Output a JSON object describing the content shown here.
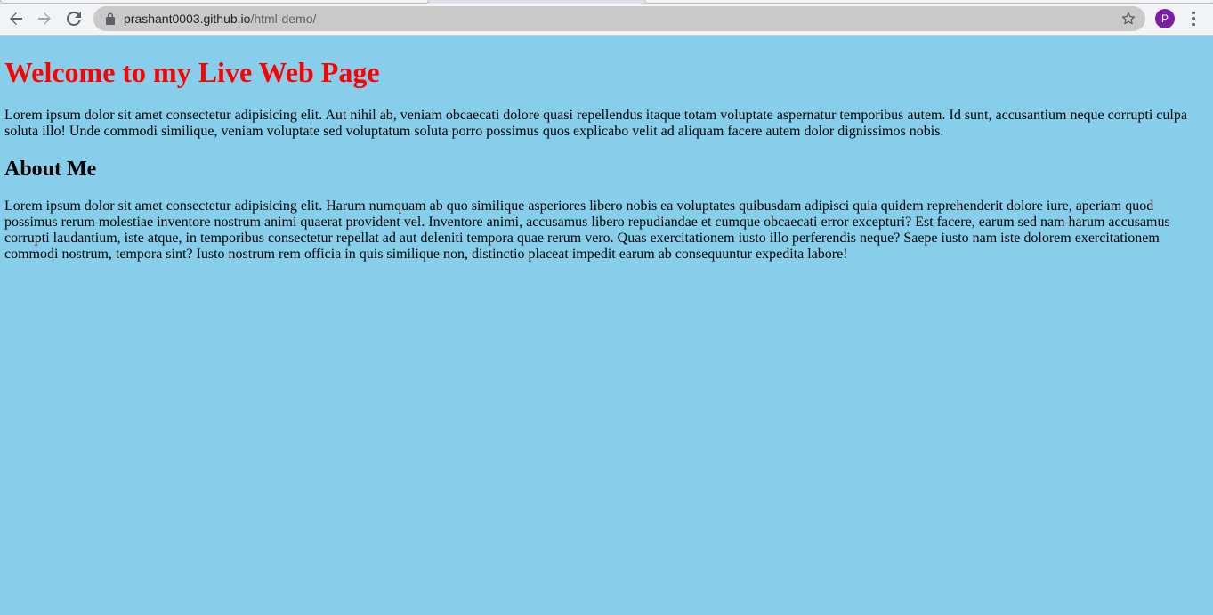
{
  "browser": {
    "url_host": "prashant0003.github.io",
    "url_path": "/html-demo/",
    "profile_initial": "P",
    "icons": [
      "back-arrow-icon",
      "forward-arrow-icon",
      "reload-icon",
      "lock-icon",
      "star-icon",
      "more-vert-icon"
    ]
  },
  "page": {
    "heading": "Welcome to my Live Web Page",
    "intro": "Lorem ipsum dolor sit amet consectetur adipisicing elit. Aut nihil ab, veniam obcaecati dolore quasi repellendus itaque totam voluptate aspernatur temporibus autem. Id sunt, accusantium neque corrupti culpa soluta illo! Unde commodi similique, veniam voluptate sed voluptatum soluta porro possimus quos explicabo velit ad aliquam facere autem dolor dignissimos nobis.",
    "about_heading": "About Me",
    "about_text": "Lorem ipsum dolor sit amet consectetur adipisicing elit. Harum numquam ab quo similique asperiores libero nobis ea voluptates quibusdam adipisci quia quidem reprehenderit dolore iure, aperiam quod possimus rerum molestiae inventore nostrum animi quaerat provident vel. Inventore animi, accusamus libero repudiandae et cumque obcaecati error excepturi? Est facere, earum sed nam harum accusamus corrupti laudantium, iste atque, in temporibus consectetur repellat ad aut deleniti tempora quae rerum vero. Quas exercitationem iusto illo perferendis neque? Saepe iusto nam iste dolorem exercitationem commodi nostrum, tempora sint? Iusto nostrum rem officia in quis similique non, distinctio placeat impedit earum ab consequuntur expedita labore!"
  },
  "colors": {
    "page_background": "#87ceeb",
    "heading": "#ff0000",
    "avatar": "#7b1fa2"
  }
}
